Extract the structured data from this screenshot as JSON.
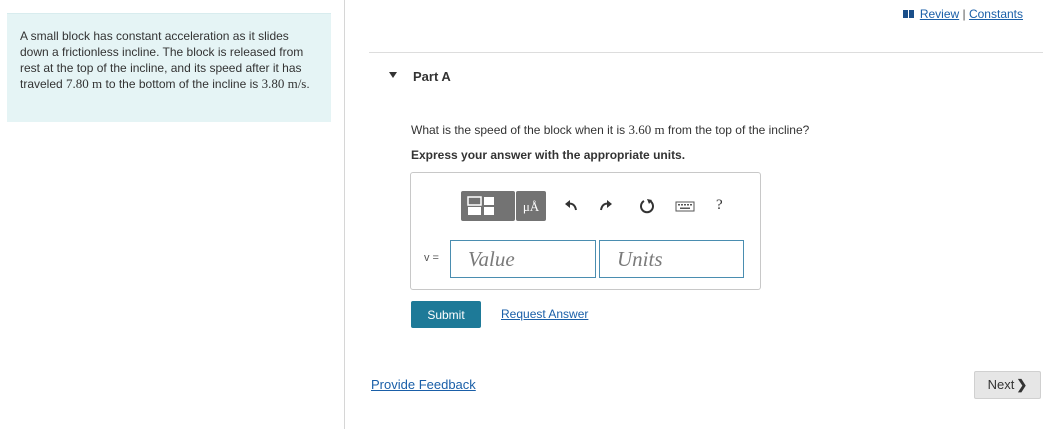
{
  "problem": {
    "text_before": "A small block has constant acceleration as it slides down a frictionless incline. The block is released from rest at the top of the incline, and its speed after it has traveled ",
    "distance": "7.80 m",
    "text_middle": " to the bottom of the incline is ",
    "speed": "3.80 m/s",
    "text_end": "."
  },
  "top_links": {
    "review": "Review",
    "separator": " | ",
    "constants": "Constants"
  },
  "part": {
    "title": "Part A",
    "question_before": "What is the speed of the block when it is ",
    "question_value": "3.60 m",
    "question_after": " from the top of the incline?",
    "instruction": "Express your answer with the appropriate units."
  },
  "toolbar": {
    "units_glyph": "μÅ",
    "help": "?",
    "icons": [
      "templates-icon",
      "units-icon",
      "undo-icon",
      "redo-icon",
      "reset-icon",
      "keyboard-icon",
      "help-icon"
    ]
  },
  "answer": {
    "variable_label": "v =",
    "value_placeholder": "Value",
    "value": "",
    "units_placeholder": "Units",
    "units": ""
  },
  "actions": {
    "submit": "Submit",
    "request_answer": "Request Answer",
    "provide_feedback": "Provide Feedback",
    "next": "Next"
  },
  "colors": {
    "problem_panel_bg": "#e5f4f5",
    "submit_bg": "#1e7a98",
    "link": "#1a5fa8",
    "toolbar_button": "#737373",
    "input_border": "#4a8db0"
  }
}
